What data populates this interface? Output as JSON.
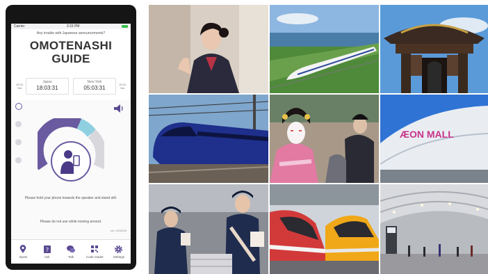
{
  "app": {
    "status_left": "Carrier",
    "status_time": "3:15 PM",
    "ask_text": "Any trouble with Japanese announcements?",
    "title_line1": "OMOTENASHI",
    "title_line2": "GUIDE",
    "clocks": [
      {
        "date": "15:33 Sat",
        "city": "Japan",
        "time": "18:03:31"
      },
      {
        "date": "15:33 Sat",
        "city": "New York",
        "time": "05:03:31"
      }
    ],
    "instruction": "Please hold your phone towards the speaker and stand still.",
    "warning": "Please do not use while moving around.",
    "version": "ver. 2016100",
    "tabs": [
      {
        "label": "Spots",
        "icon": "map-pin-icon"
      },
      {
        "label": "Ask",
        "icon": "question-icon"
      },
      {
        "label": "Talk",
        "icon": "chat-bubble-icon"
      },
      {
        "label": "Code reader",
        "icon": "qr-code-icon"
      },
      {
        "label": "Settings",
        "icon": "gear-icon"
      }
    ],
    "accent": "#5b4a93"
  },
  "photos": [
    {
      "name": "photo-station-attendant"
    },
    {
      "name": "photo-shinkansen"
    },
    {
      "name": "photo-castle-gate"
    },
    {
      "name": "photo-blue-train"
    },
    {
      "name": "photo-kabuki-performance"
    },
    {
      "name": "photo-aeon-mall",
      "sign": "ÆON MALL"
    },
    {
      "name": "photo-police-officers"
    },
    {
      "name": "photo-express-trains"
    },
    {
      "name": "photo-airport-terminal"
    }
  ]
}
